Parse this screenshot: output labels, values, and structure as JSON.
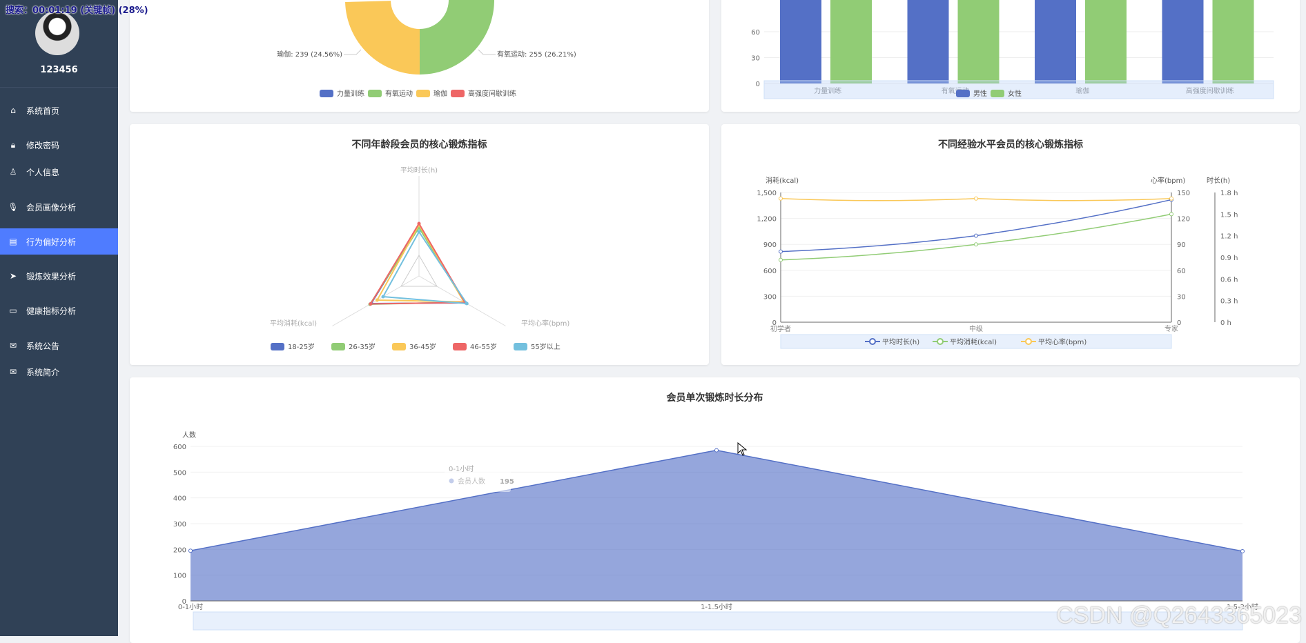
{
  "overlay": {
    "search_text": "搜索：00:01:19 (关键帧) (28%)"
  },
  "user": {
    "name": "123456"
  },
  "menu": [
    {
      "label": "系统首页",
      "icon": "home-icon",
      "active": false
    },
    {
      "label": "修改密码",
      "icon": "lock-icon",
      "active": false
    },
    {
      "label": "个人信息",
      "icon": "user-icon",
      "active": false
    },
    {
      "label": "会员画像分析",
      "icon": "microphone-icon",
      "active": false
    },
    {
      "label": "行为偏好分析",
      "icon": "clipboard-icon",
      "active": true
    },
    {
      "label": "锻炼效果分析",
      "icon": "send-icon",
      "active": false
    },
    {
      "label": "健康指标分析",
      "icon": "monitor-icon",
      "active": false
    },
    {
      "label": "系统公告",
      "icon": "mail-icon",
      "active": false
    },
    {
      "label": "系统简介",
      "icon": "mail-icon",
      "active": false
    }
  ],
  "colors": {
    "blue": "#5470c6",
    "green": "#91cc75",
    "yellow": "#fac858",
    "red": "#ee6666",
    "cyan": "#73c0de",
    "sidebar": "#304156",
    "active": "#4f7cff"
  },
  "watermark": "CSDN @Q2643365023",
  "chart_data": [
    {
      "type": "pie",
      "title": "",
      "labels": [
        "瑜伽: 239 (24.56%)",
        "有氧运动: 255 (26.21%)"
      ],
      "legend": [
        "力量训练",
        "有氧运动",
        "瑜伽",
        "高强度间歇训练"
      ],
      "slices": [
        {
          "name": "有氧运动",
          "value": 255,
          "percent": 26.21
        },
        {
          "name": "瑜伽",
          "value": 239,
          "percent": 24.56
        }
      ]
    },
    {
      "type": "bar",
      "title": "",
      "categories": [
        "力量训练",
        "有氧运动",
        "瑜伽",
        "高强度间歇训练"
      ],
      "y_ticks": [
        "0",
        "30",
        "60"
      ],
      "ylim": [
        0,
        100
      ],
      "legend": [
        "男性",
        "女性"
      ],
      "series": [
        {
          "name": "男性",
          "values": [
            100,
            100,
            100,
            100
          ]
        },
        {
          "name": "女性",
          "values": [
            100,
            100,
            100,
            100
          ]
        }
      ]
    },
    {
      "type": "radar",
      "title": "不同年龄段会员的核心锻炼指标",
      "indicators": [
        "平均时长(h)",
        "平均心率(bpm)",
        "平均消耗(kcal)"
      ],
      "legend": [
        "18-25岁",
        "26-35岁",
        "36-45岁",
        "46-55岁",
        "55岁以上"
      ],
      "series": [
        {
          "name": "18-25岁",
          "values": [
            0.72,
            0.78,
            0.8
          ]
        },
        {
          "name": "26-35岁",
          "values": [
            0.7,
            0.76,
            0.82
          ]
        },
        {
          "name": "36-45岁",
          "values": [
            0.74,
            0.75,
            0.7
          ]
        },
        {
          "name": "46-55岁",
          "values": [
            0.76,
            0.77,
            0.81
          ]
        },
        {
          "name": "55岁以上",
          "values": [
            0.64,
            0.8,
            0.6
          ]
        }
      ]
    },
    {
      "type": "line",
      "title": "不同经验水平会员的核心锻炼指标",
      "categories": [
        "初学者",
        "中级",
        "专家"
      ],
      "y_left_label": "消耗(kcal)",
      "y_left_ticks": [
        "0",
        "300",
        "600",
        "900",
        "1,200",
        "1,500"
      ],
      "y_left_range": [
        0,
        1500
      ],
      "y_mid_label": "心率(bpm)",
      "y_mid_ticks": [
        "0",
        "30",
        "60",
        "90",
        "120",
        "150"
      ],
      "y_mid_range": [
        0,
        150
      ],
      "y_right_label": "时长(h)",
      "y_right_ticks": [
        "0 h",
        "0.3 h",
        "0.6 h",
        "0.9 h",
        "1.2 h",
        "1.5 h",
        "1.8 h"
      ],
      "y_right_range": [
        0,
        1.8
      ],
      "legend": [
        "平均时长(h)",
        "平均消耗(kcal)",
        "平均心率(bpm)"
      ],
      "series": [
        {
          "name": "平均时长(h)",
          "axis": "right",
          "values": [
            0.98,
            1.2,
            1.7
          ]
        },
        {
          "name": "平均消耗(kcal)",
          "axis": "left",
          "values": [
            720,
            900,
            1250
          ]
        },
        {
          "name": "平均心率(bpm)",
          "axis": "mid",
          "values": [
            143,
            143,
            143
          ]
        }
      ]
    },
    {
      "type": "area",
      "title": "会员单次锻炼时长分布",
      "ylabel": "人数",
      "y_ticks": [
        "0",
        "100",
        "200",
        "300",
        "400",
        "500",
        "600"
      ],
      "ylim": [
        0,
        600
      ],
      "categories": [
        "0-1小时",
        "1-1.5小时",
        "1.5-2小时"
      ],
      "series": [
        {
          "name": "会员人数",
          "values": [
            195,
            585,
            193
          ]
        }
      ],
      "tooltip": {
        "category": "0-1小时",
        "series": "会员人数",
        "value": "195"
      }
    }
  ]
}
